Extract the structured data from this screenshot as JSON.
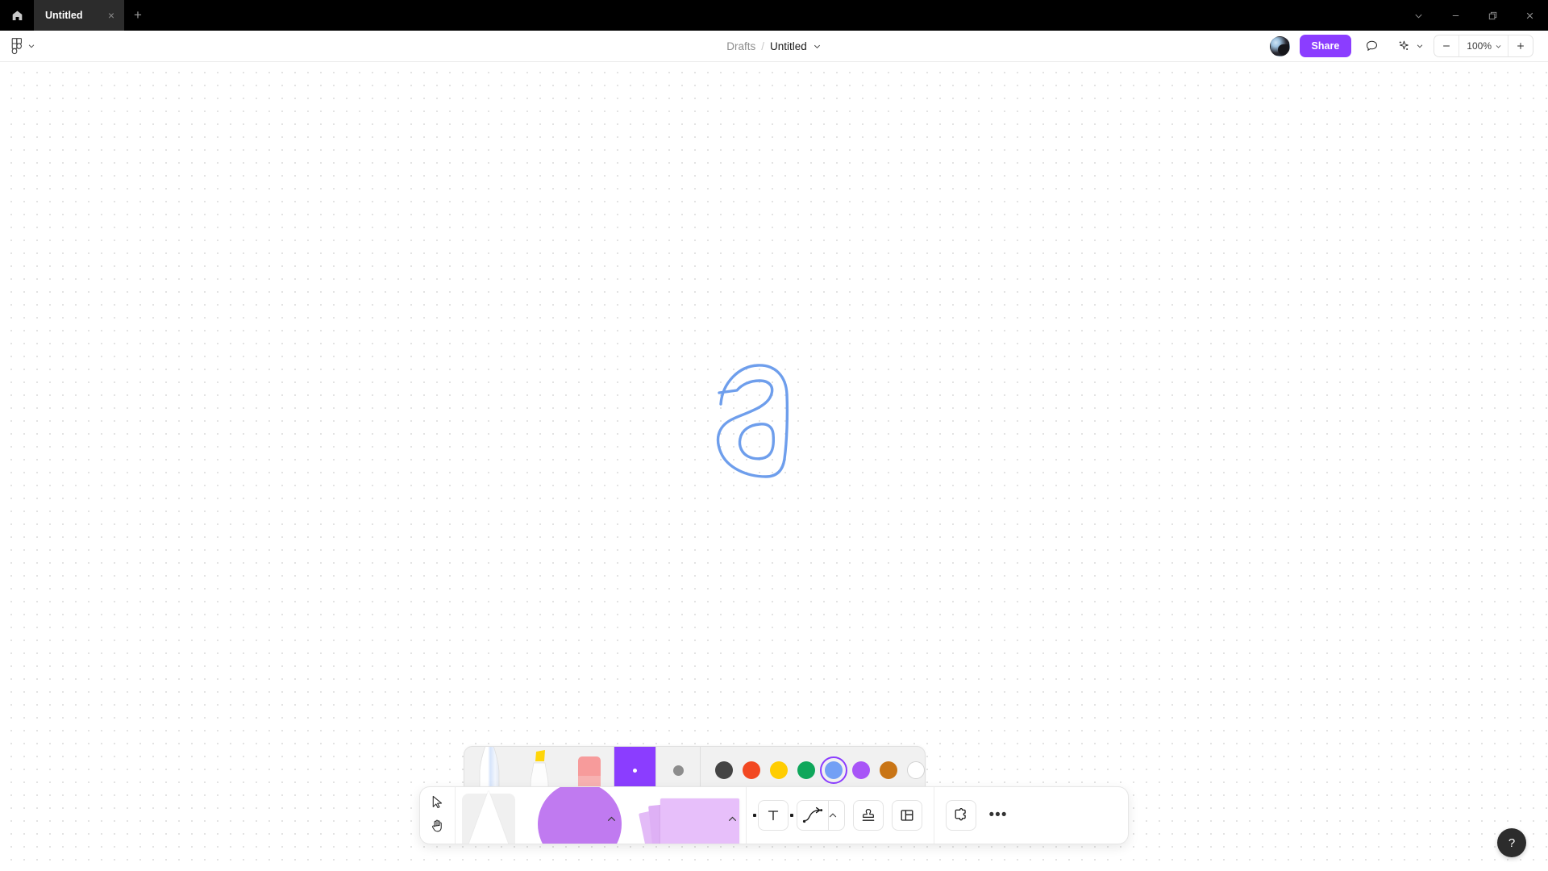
{
  "titlebar": {
    "home_icon": "home-icon",
    "tabs": [
      {
        "label": "Untitled",
        "close": "×",
        "active": true
      }
    ],
    "new_tab": "+",
    "window_controls": [
      {
        "name": "chevron-down",
        "glyph": "⌄"
      },
      {
        "name": "minimize",
        "glyph": "—"
      },
      {
        "name": "maximize",
        "glyph": "❐"
      },
      {
        "name": "close",
        "glyph": "×"
      }
    ]
  },
  "header": {
    "menu_icon": "figma-logo-icon",
    "menu_chevron": "chevron-down-icon",
    "breadcrumb": {
      "folder": "Drafts",
      "separator": "/",
      "title": "Untitled",
      "chevron": "chevron-down-icon"
    },
    "avatar": "user-avatar",
    "share_label": "Share",
    "comment_icon": "comment-bubble-icon",
    "ai_icon": "ai-sparkle-icon",
    "ai_chevron": "chevron-down-icon",
    "zoom": {
      "minus": "—",
      "value": "100%",
      "chevron": "chevron-down-icon",
      "plus": "+"
    }
  },
  "canvas": {
    "grid": "dot-grid",
    "drawing": {
      "name": "handwritten-letter-a",
      "stroke_color": "#6e9eec"
    }
  },
  "penbar": {
    "tools": [
      {
        "name": "pen-tool",
        "label": "Pen",
        "selected": true
      },
      {
        "name": "highlighter-tool",
        "label": "Highlighter",
        "selected": false
      },
      {
        "name": "eraser-tool",
        "label": "Eraser",
        "selected": false
      }
    ],
    "current_color": "#8b3dff",
    "stroke_size": "medium",
    "palette": [
      {
        "name": "color-dark-gray",
        "hex": "#444444",
        "selected": false
      },
      {
        "name": "color-red",
        "hex": "#f24822",
        "selected": false
      },
      {
        "name": "color-yellow",
        "hex": "#ffcd02",
        "selected": false
      },
      {
        "name": "color-green",
        "hex": "#0fa75b",
        "selected": false
      },
      {
        "name": "color-blue",
        "hex": "#73a0f5",
        "selected": true
      },
      {
        "name": "color-purple",
        "hex": "#a council",
        "selected": false
      },
      {
        "name": "color-orange",
        "hex": "#c97516",
        "selected": false
      },
      {
        "name": "color-white",
        "hex": "#ffffff",
        "selected": false
      }
    ]
  },
  "toolbar": {
    "cursor_tools": [
      {
        "name": "select-tool",
        "label": "Select"
      },
      {
        "name": "hand-tool",
        "label": "Hand"
      }
    ],
    "draw_tool": {
      "name": "draw-tool",
      "label": "Draw",
      "selected": true
    },
    "shape_tool": {
      "name": "shape-tool",
      "label": "Shape",
      "chevron": "chevron-up-icon"
    },
    "sticky_tool": {
      "name": "sticky-note-tool",
      "label": "Sticky note",
      "chevron": "chevron-up-icon"
    },
    "text_tool": {
      "name": "text-tool",
      "label": "Text",
      "glyph": "T"
    },
    "connector_tool": {
      "name": "connector-tool",
      "label": "Connector",
      "chevron": "chevron-up-icon"
    },
    "stamp_tool": {
      "name": "stamp-tool",
      "label": "Stamp"
    },
    "template_tool": {
      "name": "template-tool",
      "label": "Template"
    },
    "widget_tool": {
      "name": "widget-tool",
      "label": "Widget"
    },
    "more": {
      "name": "more-options",
      "label": "•••"
    }
  },
  "help": {
    "label": "?"
  }
}
